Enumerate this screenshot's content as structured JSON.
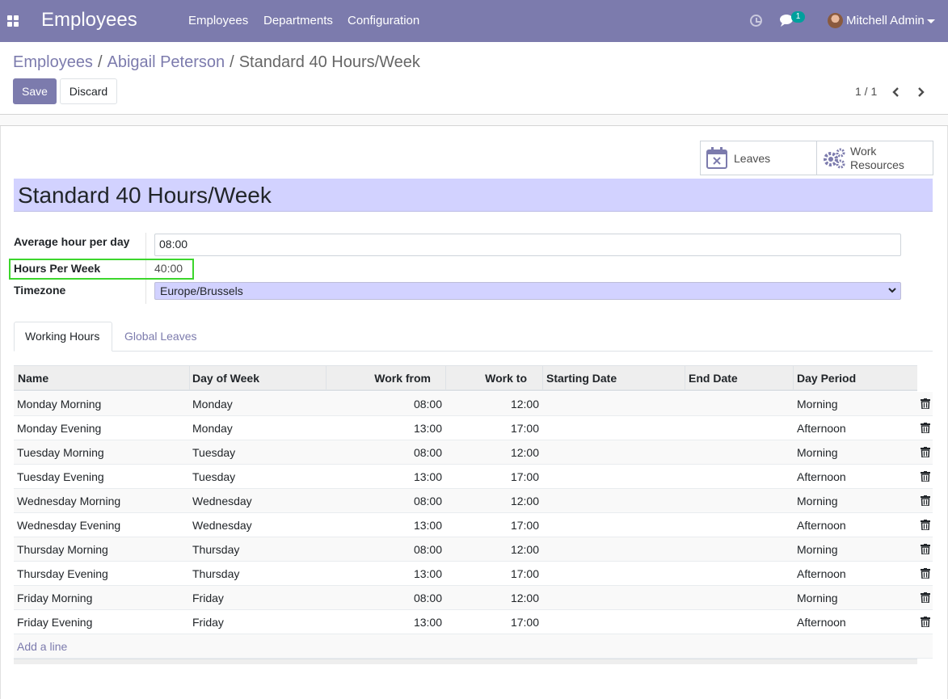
{
  "navbar": {
    "app_title": "Employees",
    "menu": [
      "Employees",
      "Departments",
      "Configuration"
    ],
    "chat_badge": "1",
    "user_name": "Mitchell Admin"
  },
  "breadcrumb": {
    "items": [
      "Employees",
      "Abigail Peterson",
      "Standard 40 Hours/Week"
    ],
    "separator": "/"
  },
  "buttons": {
    "save": "Save",
    "discard": "Discard"
  },
  "pager": {
    "value": "1 / 1"
  },
  "stat_buttons": {
    "leaves": "Leaves",
    "resources_line1": "Work",
    "resources_line2": "Resources"
  },
  "form": {
    "title": "Standard 40 Hours/Week",
    "avg_label": "Average hour per day",
    "avg_value": "08:00",
    "hpw_label": "Hours Per Week",
    "hpw_value": "40:00",
    "tz_label": "Timezone",
    "tz_value": "Europe/Brussels"
  },
  "tabs": [
    "Working Hours",
    "Global Leaves"
  ],
  "table": {
    "headers": [
      "Name",
      "Day of Week",
      "Work from",
      "Work to",
      "Starting Date",
      "End Date",
      "Day Period"
    ],
    "rows": [
      {
        "name": "Monday Morning",
        "day": "Monday",
        "from": "08:00",
        "to": "12:00",
        "start": "",
        "end": "",
        "period": "Morning"
      },
      {
        "name": "Monday Evening",
        "day": "Monday",
        "from": "13:00",
        "to": "17:00",
        "start": "",
        "end": "",
        "period": "Afternoon"
      },
      {
        "name": "Tuesday Morning",
        "day": "Tuesday",
        "from": "08:00",
        "to": "12:00",
        "start": "",
        "end": "",
        "period": "Morning"
      },
      {
        "name": "Tuesday Evening",
        "day": "Tuesday",
        "from": "13:00",
        "to": "17:00",
        "start": "",
        "end": "",
        "period": "Afternoon"
      },
      {
        "name": "Wednesday Morning",
        "day": "Wednesday",
        "from": "08:00",
        "to": "12:00",
        "start": "",
        "end": "",
        "period": "Morning"
      },
      {
        "name": "Wednesday Evening",
        "day": "Wednesday",
        "from": "13:00",
        "to": "17:00",
        "start": "",
        "end": "",
        "period": "Afternoon"
      },
      {
        "name": "Thursday Morning",
        "day": "Thursday",
        "from": "08:00",
        "to": "12:00",
        "start": "",
        "end": "",
        "period": "Morning"
      },
      {
        "name": "Thursday Evening",
        "day": "Thursday",
        "from": "13:00",
        "to": "17:00",
        "start": "",
        "end": "",
        "period": "Afternoon"
      },
      {
        "name": "Friday Morning",
        "day": "Friday",
        "from": "08:00",
        "to": "12:00",
        "start": "",
        "end": "",
        "period": "Morning"
      },
      {
        "name": "Friday Evening",
        "day": "Friday",
        "from": "13:00",
        "to": "17:00",
        "start": "",
        "end": "",
        "period": "Afternoon"
      }
    ],
    "add_line": "Add a line"
  },
  "colors": {
    "brand": "#7c7bad",
    "required_field": "#d2d2ff",
    "highlight": "#3cd62c",
    "badge": "#00a09d"
  }
}
